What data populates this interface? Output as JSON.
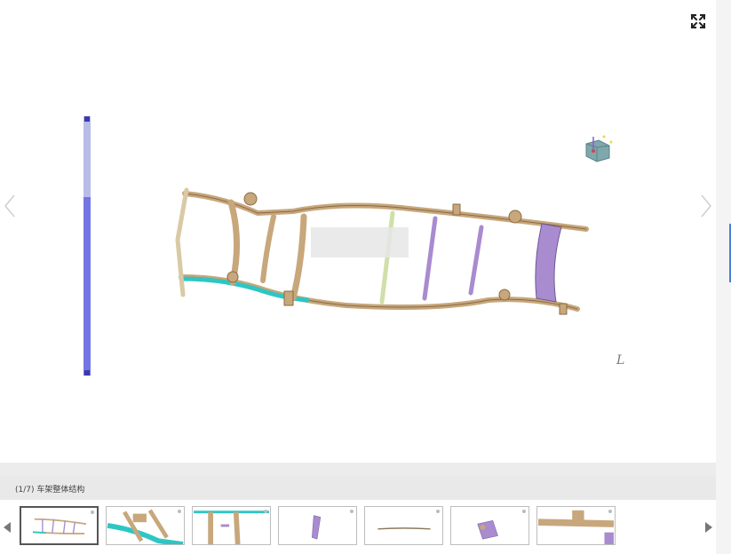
{
  "viewer": {
    "caption": "(1/7) 车架整体结构",
    "zoom_level": 0.69,
    "axis_label": "L"
  },
  "icons": {
    "fullscreen": "expand-icon",
    "prev": "chevron-left-icon",
    "next": "chevron-right-icon",
    "orientation": "view-cube-icon"
  },
  "colors": {
    "frame": "#c7a77b",
    "frame_dark": "#8a6b45",
    "crossmember": "#a98bd0",
    "highlight": "#2ec6c4",
    "slider_fill": "#7475e4",
    "slider_track": "#b8bce8"
  },
  "thumbnails": [
    {
      "name": "thumb-1",
      "active": true
    },
    {
      "name": "thumb-2",
      "active": false
    },
    {
      "name": "thumb-3",
      "active": false
    },
    {
      "name": "thumb-4",
      "active": false
    },
    {
      "name": "thumb-5",
      "active": false
    },
    {
      "name": "thumb-6",
      "active": false
    },
    {
      "name": "thumb-7",
      "active": false
    }
  ]
}
